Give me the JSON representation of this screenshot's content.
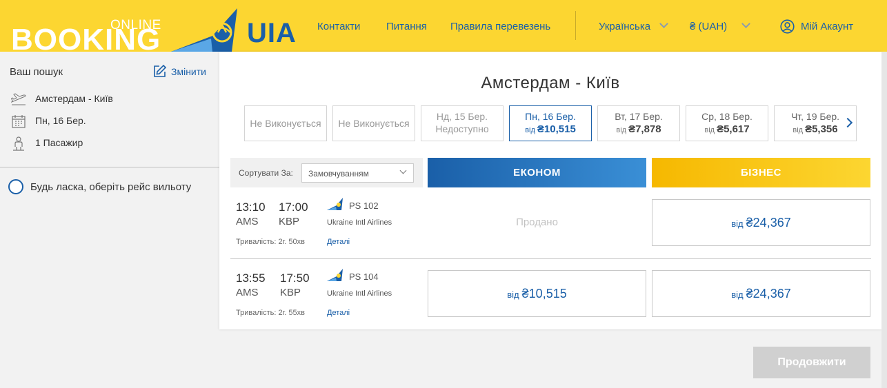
{
  "header": {
    "logo_online": "ONLINE",
    "logo_booking": "BOOKING",
    "logo_brand": "UIA",
    "nav": [
      "Контакти",
      "Питання",
      "Правила перевезень"
    ],
    "language": "Українська",
    "currency": "₴ (UAH)",
    "account": "Мій Акаунт"
  },
  "sidebar": {
    "title": "Ваш пошук",
    "edit_label": "Змінити",
    "route": "Амстердам - Київ",
    "date": "Пн, 16 Бер.",
    "passengers": "1 Пасажир",
    "prompt": "Будь ласка, оберіть рейс вильоту"
  },
  "main": {
    "route_title": "Амстердам - Київ",
    "dates": [
      {
        "na": "Не Виконується"
      },
      {
        "na": "Не Виконується"
      },
      {
        "day": "Нд, 15 Бер.",
        "status": "Недоступно"
      },
      {
        "day": "Пн, 16 Бер.",
        "from": "від",
        "price": "₴10,515"
      },
      {
        "day": "Вт, 17 Бер.",
        "from": "від",
        "price": "₴7,878"
      },
      {
        "day": "Ср, 18 Бер.",
        "from": "від",
        "price": "₴5,617"
      },
      {
        "day": "Чт, 19 Бер.",
        "from": "від",
        "price": "₴5,356"
      }
    ],
    "sort_label": "Сортувати За:",
    "sort_value": "Замовчуванням",
    "class_economy": "ЕКОНОМ",
    "class_business": "БІЗНЕС",
    "flights": [
      {
        "dep_time": "13:10",
        "arr_time": "17:00",
        "dep_code": "AMS",
        "arr_code": "KBP",
        "number": "PS 102",
        "airline": "Ukraine Intl Airlines",
        "duration": "Тривалість: 2г. 50хв",
        "details": "Деталі",
        "economy_sold": "Продано",
        "business_from": "від",
        "business_price": "₴24,367"
      },
      {
        "dep_time": "13:55",
        "arr_time": "17:50",
        "dep_code": "AMS",
        "arr_code": "KBP",
        "number": "PS 104",
        "airline": "Ukraine Intl Airlines",
        "duration": "Тривалість: 2г. 55хв",
        "details": "Деталі",
        "economy_from": "від",
        "economy_price": "₴10,515",
        "business_from": "від",
        "business_price": "₴24,367"
      }
    ],
    "continue_label": "Продовжити"
  },
  "colors": {
    "brand_yellow": "#fcd631",
    "brand_blue": "#1a5fa8"
  }
}
